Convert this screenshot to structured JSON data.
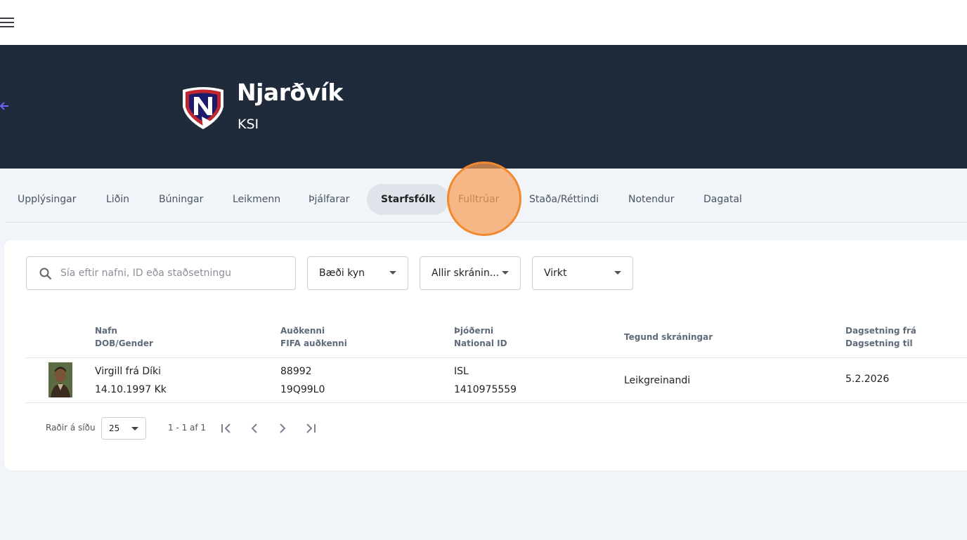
{
  "colors": {
    "hero_bg": "#1f2a3a",
    "page_bg": "#f1f4f9",
    "active_tab_bg": "#dfe3ea",
    "accent_back": "#6b63ff",
    "click_indicator": "#f08a2c"
  },
  "topbar": {
    "menu_icon": "hamburger-menu-icon"
  },
  "hero": {
    "back_icon": "arrow-left-icon",
    "club_name": "Njarðvík",
    "club_sub": "KSI",
    "logo_icon": "club-crest-shield"
  },
  "tabs": [
    {
      "label": "Upplýsingar",
      "active": false
    },
    {
      "label": "Liðin",
      "active": false
    },
    {
      "label": "Búningar",
      "active": false
    },
    {
      "label": "Leikmenn",
      "active": false
    },
    {
      "label": "Þjálfarar",
      "active": false
    },
    {
      "label": "Starfsfólk",
      "active": true
    },
    {
      "label": "Fulltrúar",
      "active": false
    },
    {
      "label": "Staða/Réttindi",
      "active": false
    },
    {
      "label": "Notendur",
      "active": false
    },
    {
      "label": "Dagatal",
      "active": false
    }
  ],
  "filters": {
    "search_placeholder": "Sía eftir nafni, ID eða staðsetningu",
    "gender_value": "Bæði kyn",
    "registration_value": "Allir skránin...",
    "status_value": "Virkt"
  },
  "table": {
    "headers": {
      "name": "Nafn",
      "dob_gender": "DOB/Gender",
      "id": "Auðkenni",
      "fifa_id": "FIFA auðkenni",
      "nationality": "Þjóðerni",
      "national_id": "National ID",
      "registration_type": "Tegund skráningar",
      "date_from": "Dagsetning frá",
      "date_to": "Dagsetning til"
    },
    "rows": [
      {
        "name": "Virgill frá Díki",
        "dob_gender": "14.10.1997 Kk",
        "id": "88992",
        "fifa_id": "19Q99L0",
        "nationality": "ISL",
        "national_id": "1410975559",
        "registration_type": "Leikgreinandi",
        "date_from": "5.2.2026"
      }
    ]
  },
  "pagination": {
    "rows_label": "Raðir á síðu",
    "rows_per_page": "25",
    "range": "1 - 1 af 1"
  }
}
